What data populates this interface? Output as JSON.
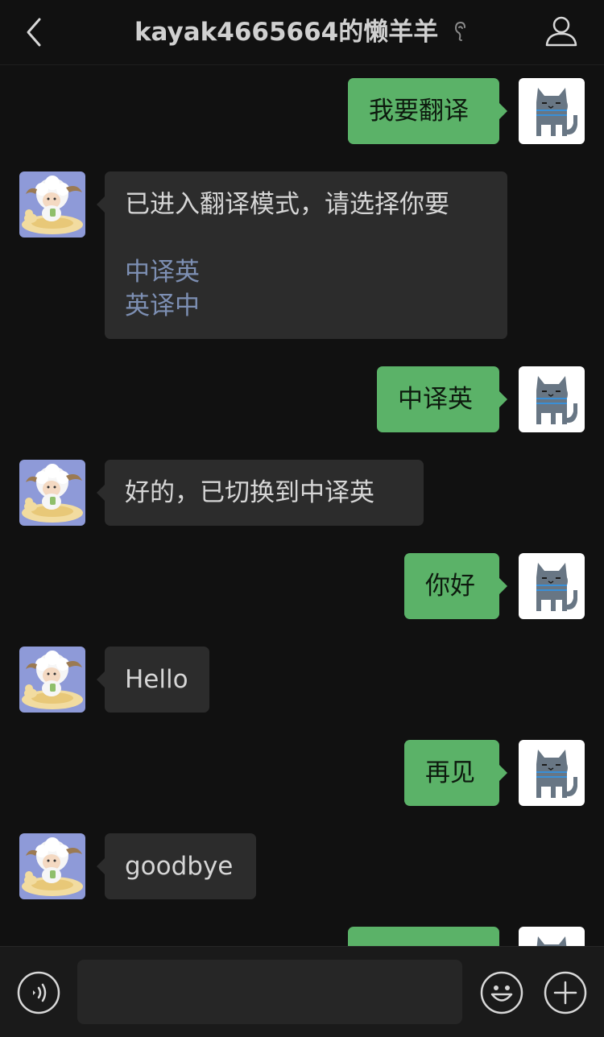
{
  "header": {
    "title": "kayak4665664的懒羊羊",
    "back_icon": "chevron-left-icon",
    "ear_icon": "ear-icon",
    "profile_icon": "person-icon"
  },
  "messages": [
    {
      "side": "right",
      "text": "我要翻译"
    },
    {
      "side": "left",
      "text": "已进入翻译模式，请选择你要",
      "options": [
        "中译英",
        "英译中"
      ]
    },
    {
      "side": "right",
      "text": "中译英"
    },
    {
      "side": "left",
      "text": "好的，已切换到中译英"
    },
    {
      "side": "right",
      "text": "你好"
    },
    {
      "side": "left",
      "text": "Hello"
    },
    {
      "side": "right",
      "text": "再见"
    },
    {
      "side": "left",
      "text": "goodbye"
    },
    {
      "side": "right",
      "text": ""
    }
  ],
  "input": {
    "value": "",
    "voice_icon": "voice-icon",
    "emoji_icon": "emoji-icon",
    "plus_icon": "plus-icon"
  },
  "colors": {
    "background": "#111111",
    "right_bubble": "#5bb268",
    "left_bubble": "#2c2c2c",
    "link": "#7d8fb3"
  }
}
